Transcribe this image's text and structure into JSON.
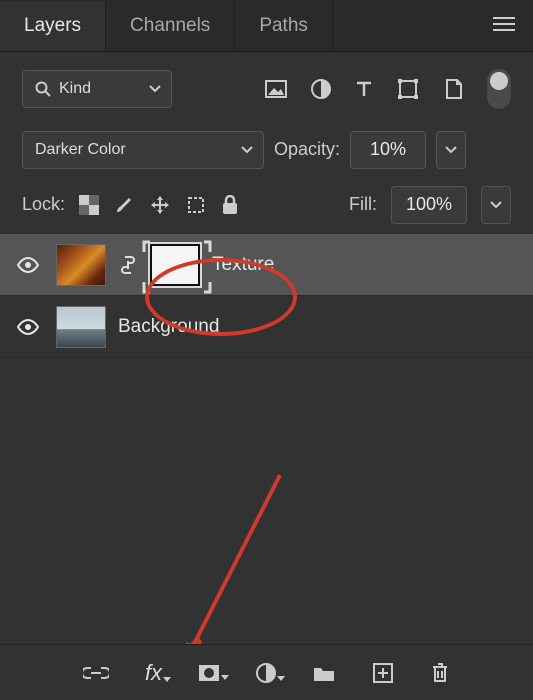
{
  "tabs": {
    "layers": "Layers",
    "channels": "Channels",
    "paths": "Paths",
    "active": "layers"
  },
  "filter": {
    "kind_label": "Kind"
  },
  "blend": {
    "mode": "Darker Color",
    "opacity_label": "Opacity:",
    "opacity_value": "10%"
  },
  "lock": {
    "label": "Lock:",
    "fill_label": "Fill:",
    "fill_value": "100%"
  },
  "layers": [
    {
      "name": "Texture",
      "visible": true,
      "selected": true,
      "has_mask": true,
      "thumb": "texture"
    },
    {
      "name": "Background",
      "visible": true,
      "selected": false,
      "has_mask": false,
      "thumb": "bg"
    }
  ],
  "icons": {
    "search": "search-icon",
    "chevron_down": "chevron-down-icon",
    "image": "image-icon",
    "half_circle": "adjustment-icon",
    "type": "type-icon",
    "shape": "shape-icon",
    "smart": "smart-object-icon",
    "checker": "transparency-lock-icon",
    "brush": "brush-lock-icon",
    "move": "move-lock-icon",
    "artboard": "artboard-lock-icon",
    "lock": "lock-all-icon",
    "link": "link-icon",
    "fx": "layer-style-icon",
    "mask": "layer-mask-icon",
    "adjustment": "new-adjustment-layer-icon",
    "folder": "new-group-icon",
    "new_layer": "new-layer-icon",
    "trash": "delete-layer-icon",
    "eye": "visibility-icon"
  }
}
